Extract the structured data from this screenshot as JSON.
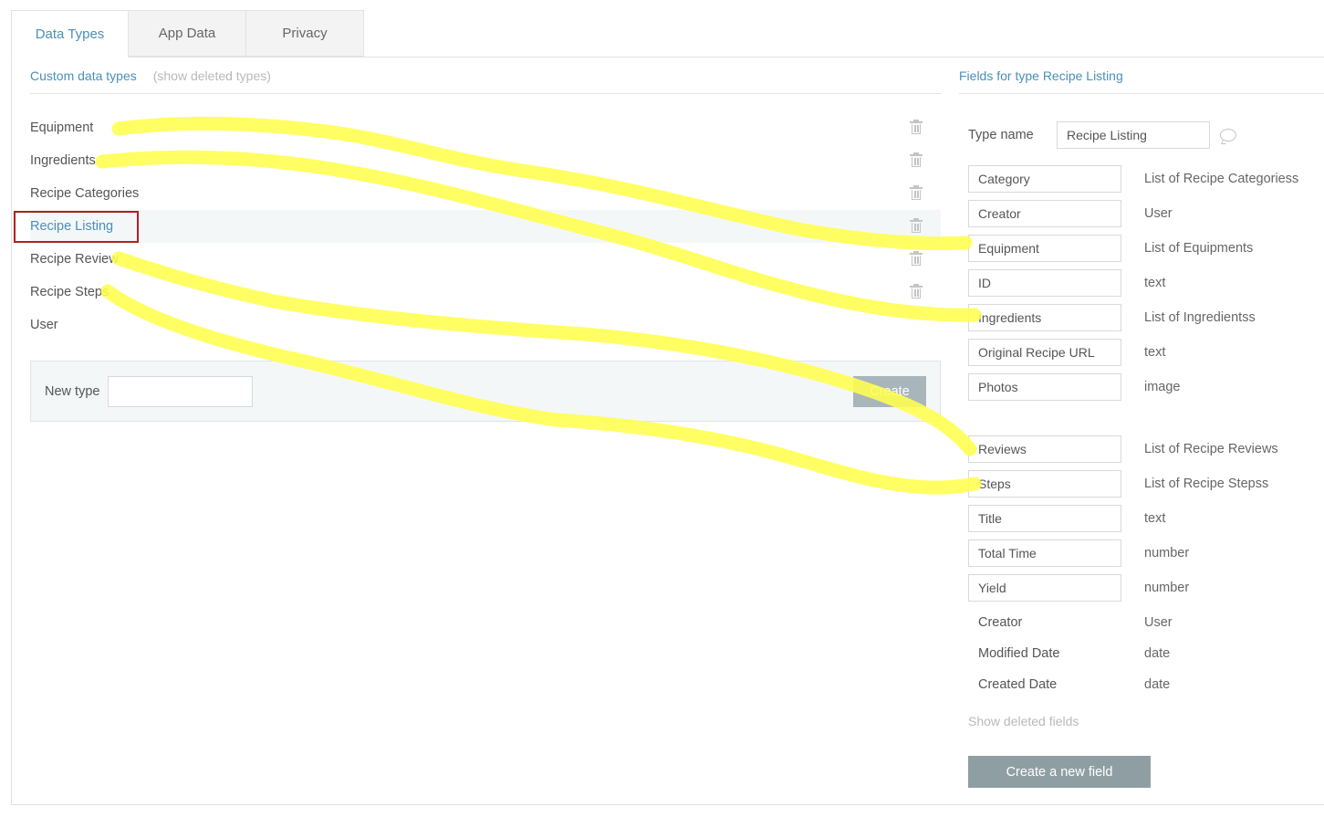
{
  "tabs": [
    {
      "label": "Data Types",
      "active": true
    },
    {
      "label": "App Data",
      "active": false
    },
    {
      "label": "Privacy",
      "active": false
    }
  ],
  "types_panel": {
    "title": "Custom data types",
    "show_deleted_link": "(show deleted types)",
    "items": [
      {
        "label": "Equipment",
        "deletable": true
      },
      {
        "label": "Ingredients",
        "deletable": true
      },
      {
        "label": "Recipe Categories",
        "deletable": true
      },
      {
        "label": "Recipe Listing",
        "deletable": true,
        "selected": true
      },
      {
        "label": "Recipe Review",
        "deletable": true
      },
      {
        "label": "Recipe Steps",
        "deletable": true
      },
      {
        "label": "User",
        "deletable": false
      }
    ],
    "new_type_label": "New type",
    "new_type_value": "",
    "create_label": "Create"
  },
  "fields_panel": {
    "title": "Fields for type Recipe Listing",
    "type_name_label": "Type name",
    "type_name_value": "Recipe Listing",
    "fields": [
      {
        "name": "Category",
        "type": "List of Recipe Categoriess"
      },
      {
        "name": "Creator",
        "type": "User"
      },
      {
        "name": "Equipment",
        "type": "List of Equipments"
      },
      {
        "name": "ID",
        "type": "text"
      },
      {
        "name": "Ingredients",
        "type": "List of Ingredientss"
      },
      {
        "name": "Original Recipe URL",
        "type": "text"
      },
      {
        "name": "Photos",
        "type": "image"
      },
      {
        "name": "Reviews",
        "type": "List of Recipe Reviews"
      },
      {
        "name": "Steps",
        "type": "List of Recipe Stepss"
      },
      {
        "name": "Title",
        "type": "text"
      },
      {
        "name": "Total Time",
        "type": "number"
      },
      {
        "name": "Yield",
        "type": "number"
      }
    ],
    "builtin_fields": [
      {
        "name": "Creator",
        "type": "User"
      },
      {
        "name": "Modified Date",
        "type": "date"
      },
      {
        "name": "Created Date",
        "type": "date"
      }
    ],
    "show_deleted_fields": "Show deleted fields",
    "create_field_label": "Create a new field"
  },
  "colors": {
    "accent": "#4a90b8",
    "highlight_marker": "#ffff4d",
    "selection_box": "#b02020",
    "button_primary": "#8f9ea3"
  },
  "icons": {
    "delete": "trash-icon",
    "comment": "comment-bubble-icon"
  }
}
